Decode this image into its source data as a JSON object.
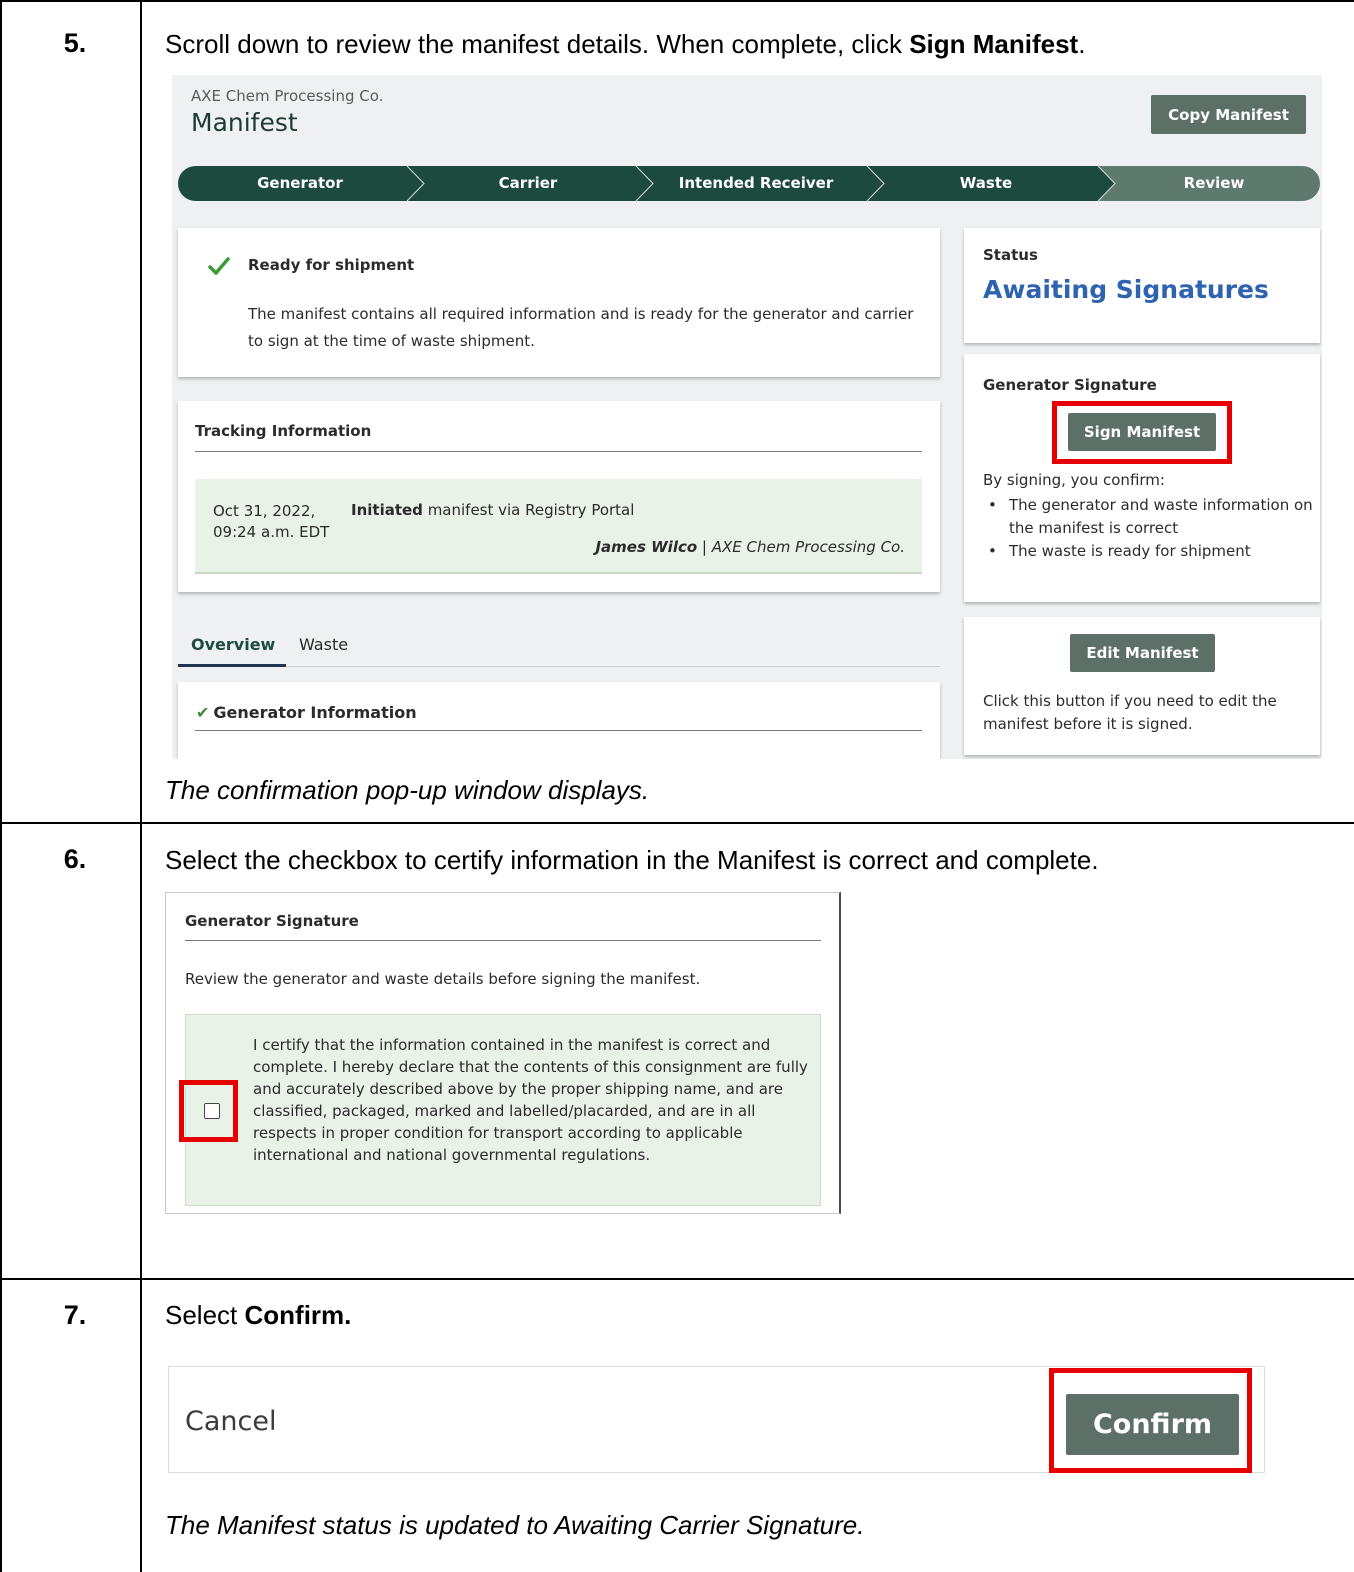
{
  "steps": [
    {
      "number": "5.",
      "instruction_prefix": "Scroll down to review the manifest details. When complete, click ",
      "instruction_bold": "Sign Manifest",
      "instruction_suffix": ".",
      "result": "The confirmation pop-up window displays."
    },
    {
      "number": "6.",
      "instruction": "Select the checkbox to certify information in the Manifest is correct and complete."
    },
    {
      "number": "7.",
      "instruction_prefix": "Select ",
      "instruction_bold": "Confirm.",
      "result": "The Manifest status is updated to Awaiting Carrier Signature."
    }
  ],
  "manifest_screen": {
    "company": "AXE Chem Processing Co.",
    "title": "Manifest",
    "copy_button": "Copy Manifest",
    "progress_steps": [
      "Generator",
      "Carrier",
      "Intended Receiver",
      "Waste",
      "Review"
    ],
    "colors": {
      "completed_step": "#1d4a3e",
      "current_step": "#5e7a6e",
      "accent_blue": "#2f63b0",
      "highlight_red": "#e60000"
    },
    "ready": {
      "icon": "check-icon",
      "title": "Ready for shipment",
      "body": "The manifest contains all required information and is ready for the generator and carrier to sign at the time of waste shipment."
    },
    "tracking": {
      "title": "Tracking Information",
      "entries": [
        {
          "date": "Oct 31, 2022,",
          "time": "09:24 a.m. EDT",
          "action_bold": "Initiated",
          "action_rest": " manifest via Registry Portal",
          "user": "James Wilco",
          "separator": " | ",
          "org": "AXE Chem Processing Co."
        }
      ]
    },
    "tabs": [
      "Overview",
      "Waste"
    ],
    "active_tab": "Overview",
    "generator_info": {
      "check": "✔",
      "title": "Generator Information"
    },
    "status": {
      "label": "Status",
      "value": "Awaiting Signatures"
    },
    "generator_signature": {
      "label": "Generator Signature",
      "button": "Sign Manifest",
      "intro": "By signing, you confirm:",
      "bullets": [
        "The generator and waste information on the manifest is correct",
        "The waste is ready for shipment"
      ]
    },
    "edit": {
      "button": "Edit Manifest",
      "note": "Click this button if you need to edit the manifest before it is signed."
    }
  },
  "signature_popup": {
    "title": "Generator Signature",
    "review_text": "Review the generator and waste details before signing the manifest.",
    "certification": "I certify that the information contained in the manifest is correct and complete. I hereby declare that the contents of this consignment are fully and accurately described above by the proper shipping name, and are classified, packaged, marked and labelled/placarded, and are in all respects in proper condition for transport according to applicable international and national governmental regulations.",
    "checkbox_checked": false
  },
  "confirm_bar": {
    "cancel": "Cancel",
    "confirm": "Confirm"
  }
}
